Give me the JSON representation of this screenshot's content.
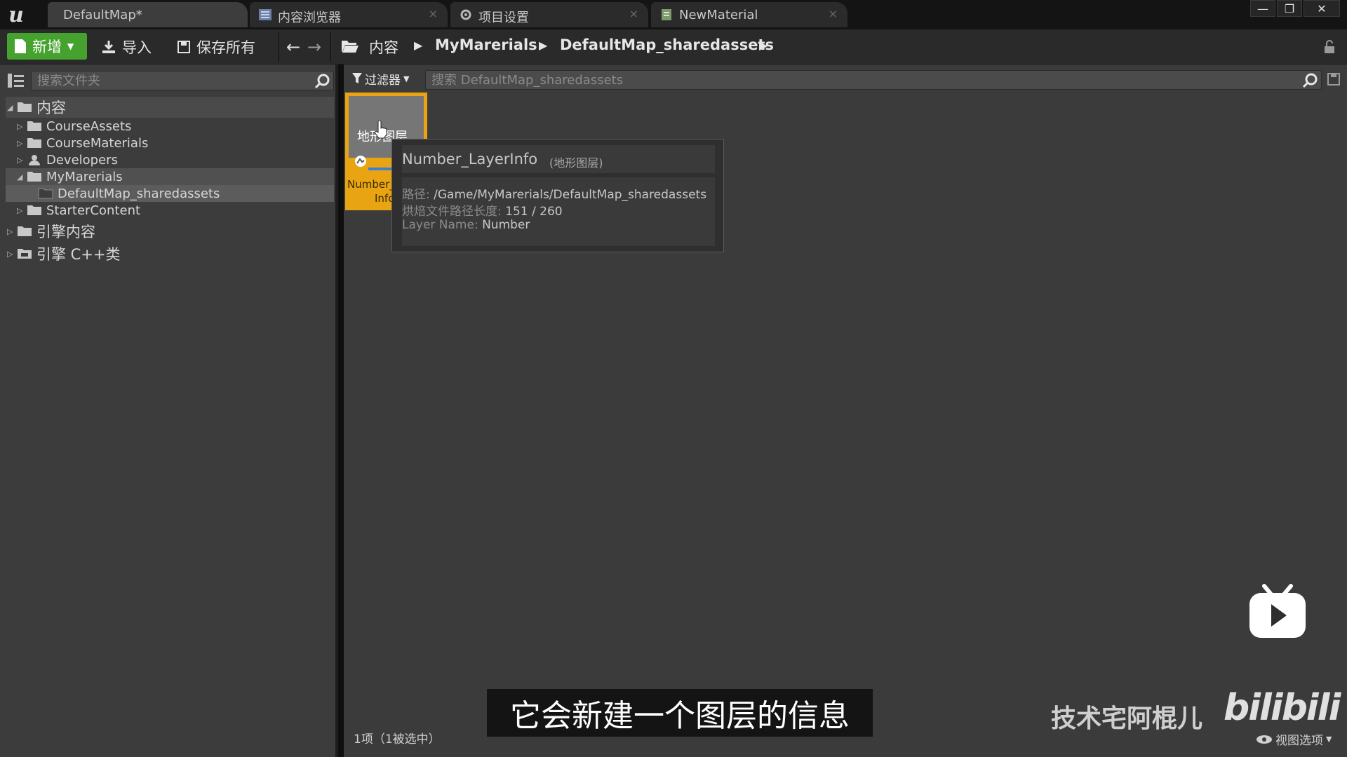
{
  "tabs": [
    {
      "label": "DefaultMap*"
    },
    {
      "label": "内容浏览器",
      "close": "×"
    },
    {
      "label": "项目设置",
      "close": "×"
    },
    {
      "label": "NewMaterial",
      "close": "×"
    }
  ],
  "window_controls": {
    "minimize": "—",
    "restore": "❐",
    "close": "✕"
  },
  "toolbar": {
    "new_label": "新增",
    "import_label": "导入",
    "save_all_label": "保存所有"
  },
  "breadcrumb": [
    "内容",
    "MyMarerials",
    "DefaultMap_sharedassets"
  ],
  "left_panel": {
    "search_placeholder": "搜索文件夹",
    "tree": [
      {
        "label": "内容"
      },
      {
        "label": "CourseAssets"
      },
      {
        "label": "CourseMaterials"
      },
      {
        "label": "Developers"
      },
      {
        "label": "MyMarerials"
      },
      {
        "label": "DefaultMap_sharedassets"
      },
      {
        "label": "StarterContent"
      },
      {
        "label": "引擎内容"
      },
      {
        "label": "引擎 C++类"
      }
    ]
  },
  "right_panel": {
    "filter_label": "过滤器",
    "search_placeholder": "搜索 DefaultMap_sharedassets"
  },
  "asset": {
    "thumb_label": "地形图层",
    "name_line1": "Number_Layer",
    "name_line2": "Info"
  },
  "tooltip": {
    "title": "Number_LayerInfo",
    "type": "(地形图层)",
    "path_key": "路径:",
    "path_val": "/Game/MyMarerials/DefaultMap_sharedassets",
    "cook_key": "烘焙文件路径长度:",
    "cook_val": "151 / 260",
    "layer_key": "Layer Name:",
    "layer_val": "Number"
  },
  "status": "1项（1被选中）",
  "view_options": "视图选项",
  "subtitle": "它会新建一个图层的信息",
  "watermark": {
    "name": "技术宅阿棍儿",
    "logo": "bilibili"
  },
  "colors": {
    "accent_green": "#46a22f",
    "selection_orange": "#e8a412"
  }
}
